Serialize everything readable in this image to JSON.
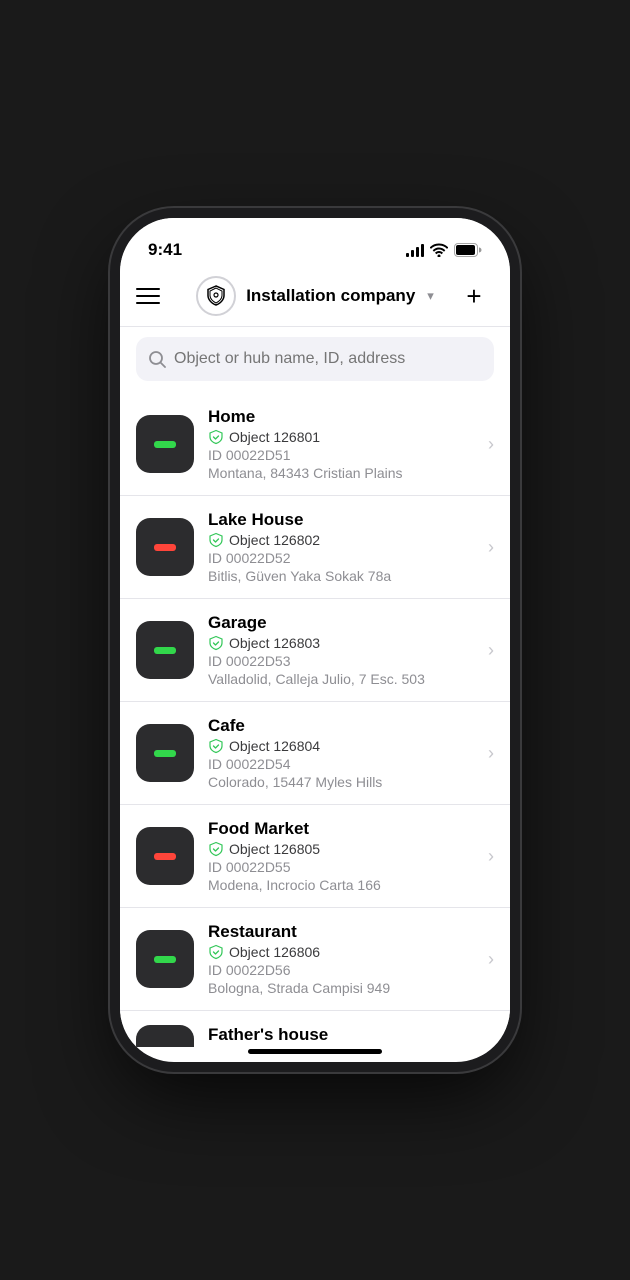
{
  "statusBar": {
    "time": "9:41"
  },
  "header": {
    "menuLabel": "Menu",
    "companyName": "Installation company",
    "addLabel": "Add"
  },
  "search": {
    "placeholder": "Object or hub name, ID, address"
  },
  "items": [
    {
      "name": "Home",
      "object": "Object 126801",
      "id": "ID 00022D51",
      "address": "Montana, 84343 Cristian Plains",
      "ledColor": "green"
    },
    {
      "name": "Lake House",
      "object": "Object 126802",
      "id": "ID 00022D52",
      "address": "Bitlis, Güven Yaka Sokak 78a",
      "ledColor": "red"
    },
    {
      "name": "Garage",
      "object": "Object 126803",
      "id": "ID 00022D53",
      "address": "Valladolid, Calleja Julio, 7 Esc. 503",
      "ledColor": "green"
    },
    {
      "name": "Cafe",
      "object": "Object 126804",
      "id": "ID 00022D54",
      "address": "Colorado, 15447 Myles Hills",
      "ledColor": "green"
    },
    {
      "name": "Food Market",
      "object": "Object 126805",
      "id": "ID 00022D55",
      "address": "Modena, Incrocio Carta 166",
      "ledColor": "red"
    },
    {
      "name": "Restaurant",
      "object": "Object 126806",
      "id": "ID 00022D56",
      "address": "Bologna, Strada Campisi 949",
      "ledColor": "green"
    }
  ],
  "partialItem": {
    "name": "Father's house"
  }
}
